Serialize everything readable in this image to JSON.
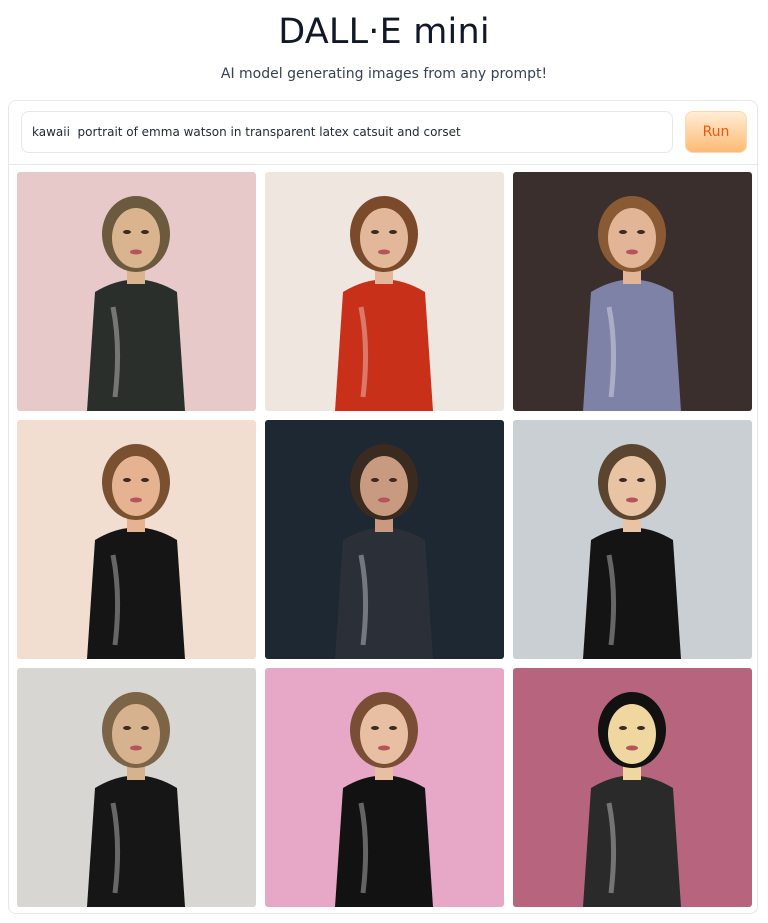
{
  "header": {
    "title": "DALL·E mini",
    "subtitle": "AI model generating images from any prompt!"
  },
  "prompt": {
    "value": "kawaii  portrait of emma watson in transparent latex catsuit and corset",
    "placeholder": ""
  },
  "run_button": {
    "label": "Run"
  },
  "colors": {
    "accent_text": "#ea580c",
    "accent_bg_top": "#ffedd5",
    "accent_bg_bottom": "#fdba74",
    "border": "#e5e7eb"
  },
  "gallery": {
    "images": [
      {
        "name": "generated-image-1",
        "bg": "#e8c9c9",
        "suit": "#2b2f2c",
        "skin": "#d9b48e",
        "hair": "#6b5a3e"
      },
      {
        "name": "generated-image-2",
        "bg": "#efe7df",
        "suit": "#c8301a",
        "skin": "#e3b89a",
        "hair": "#7a4a2a"
      },
      {
        "name": "generated-image-3",
        "bg": "#3a2f2c",
        "suit": "#7d82a6",
        "skin": "#e2b596",
        "hair": "#8a5a35"
      },
      {
        "name": "generated-image-4",
        "bg": "#f2ded0",
        "suit": "#151515",
        "skin": "#e6b392",
        "hair": "#7a5130"
      },
      {
        "name": "generated-image-5",
        "bg": "#1e2833",
        "suit": "#2a2f38",
        "skin": "#c89b80",
        "hair": "#3a2a20"
      },
      {
        "name": "generated-image-6",
        "bg": "#c9cfd2",
        "suit": "#141414",
        "skin": "#e9c4a4",
        "hair": "#5c4530"
      },
      {
        "name": "generated-image-7",
        "bg": "#d8d6d2",
        "suit": "#161616",
        "skin": "#d7b28f",
        "hair": "#7b6546"
      },
      {
        "name": "generated-image-8",
        "bg": "#e7a8c7",
        "suit": "#121212",
        "skin": "#e9bfa3",
        "hair": "#7a4e35"
      },
      {
        "name": "generated-image-9",
        "bg": "#b7657f",
        "suit": "#2a2a2a",
        "skin": "#f0d7a0",
        "hair": "#111111"
      }
    ]
  }
}
